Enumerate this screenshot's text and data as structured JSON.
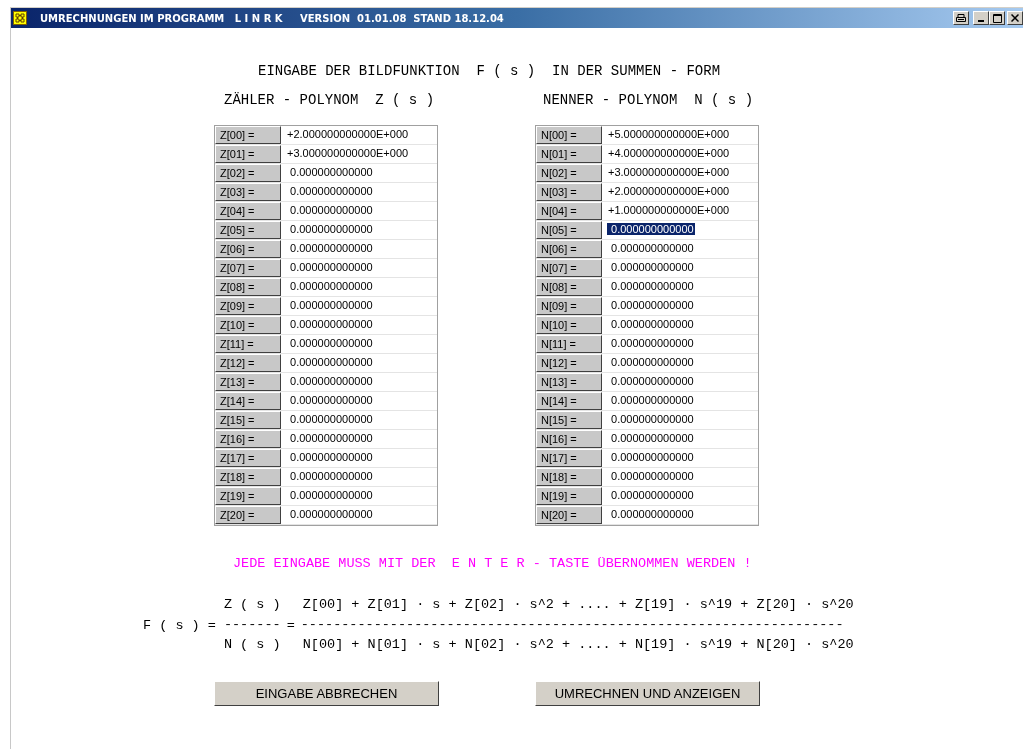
{
  "window": {
    "title": "UMRECHNUNGEN IM PROGRAMM   L I N R K     VERSION  01.01.08  STAND 18.12.04"
  },
  "heading": "EINGABE DER BILDFUNKTION  F ( s )  IN DER SUMMEN - FORM",
  "numerator": {
    "heading": "ZÄHLER - POLYNOM  Z ( s )",
    "rows": [
      {
        "label": "Z[00] =",
        "value": "+2.000000000000E+000",
        "selected": false
      },
      {
        "label": "Z[01] =",
        "value": "+3.000000000000E+000",
        "selected": false
      },
      {
        "label": "Z[02] =",
        "value": " 0.000000000000",
        "selected": false
      },
      {
        "label": "Z[03] =",
        "value": " 0.000000000000",
        "selected": false
      },
      {
        "label": "Z[04] =",
        "value": " 0.000000000000",
        "selected": false
      },
      {
        "label": "Z[05] =",
        "value": " 0.000000000000",
        "selected": false
      },
      {
        "label": "Z[06] =",
        "value": " 0.000000000000",
        "selected": false
      },
      {
        "label": "Z[07] =",
        "value": " 0.000000000000",
        "selected": false
      },
      {
        "label": "Z[08] =",
        "value": " 0.000000000000",
        "selected": false
      },
      {
        "label": "Z[09] =",
        "value": " 0.000000000000",
        "selected": false
      },
      {
        "label": "Z[10] =",
        "value": " 0.000000000000",
        "selected": false
      },
      {
        "label": "Z[11] =",
        "value": " 0.000000000000",
        "selected": false
      },
      {
        "label": "Z[12] =",
        "value": " 0.000000000000",
        "selected": false
      },
      {
        "label": "Z[13] =",
        "value": " 0.000000000000",
        "selected": false
      },
      {
        "label": "Z[14] =",
        "value": " 0.000000000000",
        "selected": false
      },
      {
        "label": "Z[15] =",
        "value": " 0.000000000000",
        "selected": false
      },
      {
        "label": "Z[16] =",
        "value": " 0.000000000000",
        "selected": false
      },
      {
        "label": "Z[17] =",
        "value": " 0.000000000000",
        "selected": false
      },
      {
        "label": "Z[18] =",
        "value": " 0.000000000000",
        "selected": false
      },
      {
        "label": "Z[19] =",
        "value": " 0.000000000000",
        "selected": false
      },
      {
        "label": "Z[20] =",
        "value": " 0.000000000000",
        "selected": false
      }
    ]
  },
  "denominator": {
    "heading": "NENNER - POLYNOM  N ( s )",
    "rows": [
      {
        "label": "N[00] =",
        "value": "+5.000000000000E+000",
        "selected": false
      },
      {
        "label": "N[01] =",
        "value": "+4.000000000000E+000",
        "selected": false
      },
      {
        "label": "N[02] =",
        "value": "+3.000000000000E+000",
        "selected": false
      },
      {
        "label": "N[03] =",
        "value": "+2.000000000000E+000",
        "selected": false
      },
      {
        "label": "N[04] =",
        "value": "+1.000000000000E+000",
        "selected": false
      },
      {
        "label": "N[05] =",
        "value": " 0.000000000000",
        "selected": true
      },
      {
        "label": "N[06] =",
        "value": " 0.000000000000",
        "selected": false
      },
      {
        "label": "N[07] =",
        "value": " 0.000000000000",
        "selected": false
      },
      {
        "label": "N[08] =",
        "value": " 0.000000000000",
        "selected": false
      },
      {
        "label": "N[09] =",
        "value": " 0.000000000000",
        "selected": false
      },
      {
        "label": "N[10] =",
        "value": " 0.000000000000",
        "selected": false
      },
      {
        "label": "N[11] =",
        "value": " 0.000000000000",
        "selected": false
      },
      {
        "label": "N[12] =",
        "value": " 0.000000000000",
        "selected": false
      },
      {
        "label": "N[13] =",
        "value": " 0.000000000000",
        "selected": false
      },
      {
        "label": "N[14] =",
        "value": " 0.000000000000",
        "selected": false
      },
      {
        "label": "N[15] =",
        "value": " 0.000000000000",
        "selected": false
      },
      {
        "label": "N[16] =",
        "value": " 0.000000000000",
        "selected": false
      },
      {
        "label": "N[17] =",
        "value": " 0.000000000000",
        "selected": false
      },
      {
        "label": "N[18] =",
        "value": " 0.000000000000",
        "selected": false
      },
      {
        "label": "N[19] =",
        "value": " 0.000000000000",
        "selected": false
      },
      {
        "label": "N[20] =",
        "value": " 0.000000000000",
        "selected": false
      }
    ]
  },
  "notice": "JEDE EINGABE MUSS MIT DER  E N T E R - TASTE ÜBERNOMMEN WERDEN !",
  "formula": {
    "lhs": "F ( s ) =",
    "short_numerator": "Z ( s )",
    "short_bar": "-------",
    "equals": "=",
    "short_denominator": "N ( s )",
    "numerator": "Z[00] + Z[01] · s + Z[02] · s^2 + .... + Z[19] · s^19 + Z[20] · s^20",
    "bar": "-------------------------------------------------------------------",
    "denominator": "N[00] + N[01] · s + N[02] · s^2 + .... + N[19] · s^19 + N[20] · s^20"
  },
  "buttons": [
    "EINGABE ABBRECHEN",
    "UMRECHNEN UND ANZEIGEN"
  ]
}
